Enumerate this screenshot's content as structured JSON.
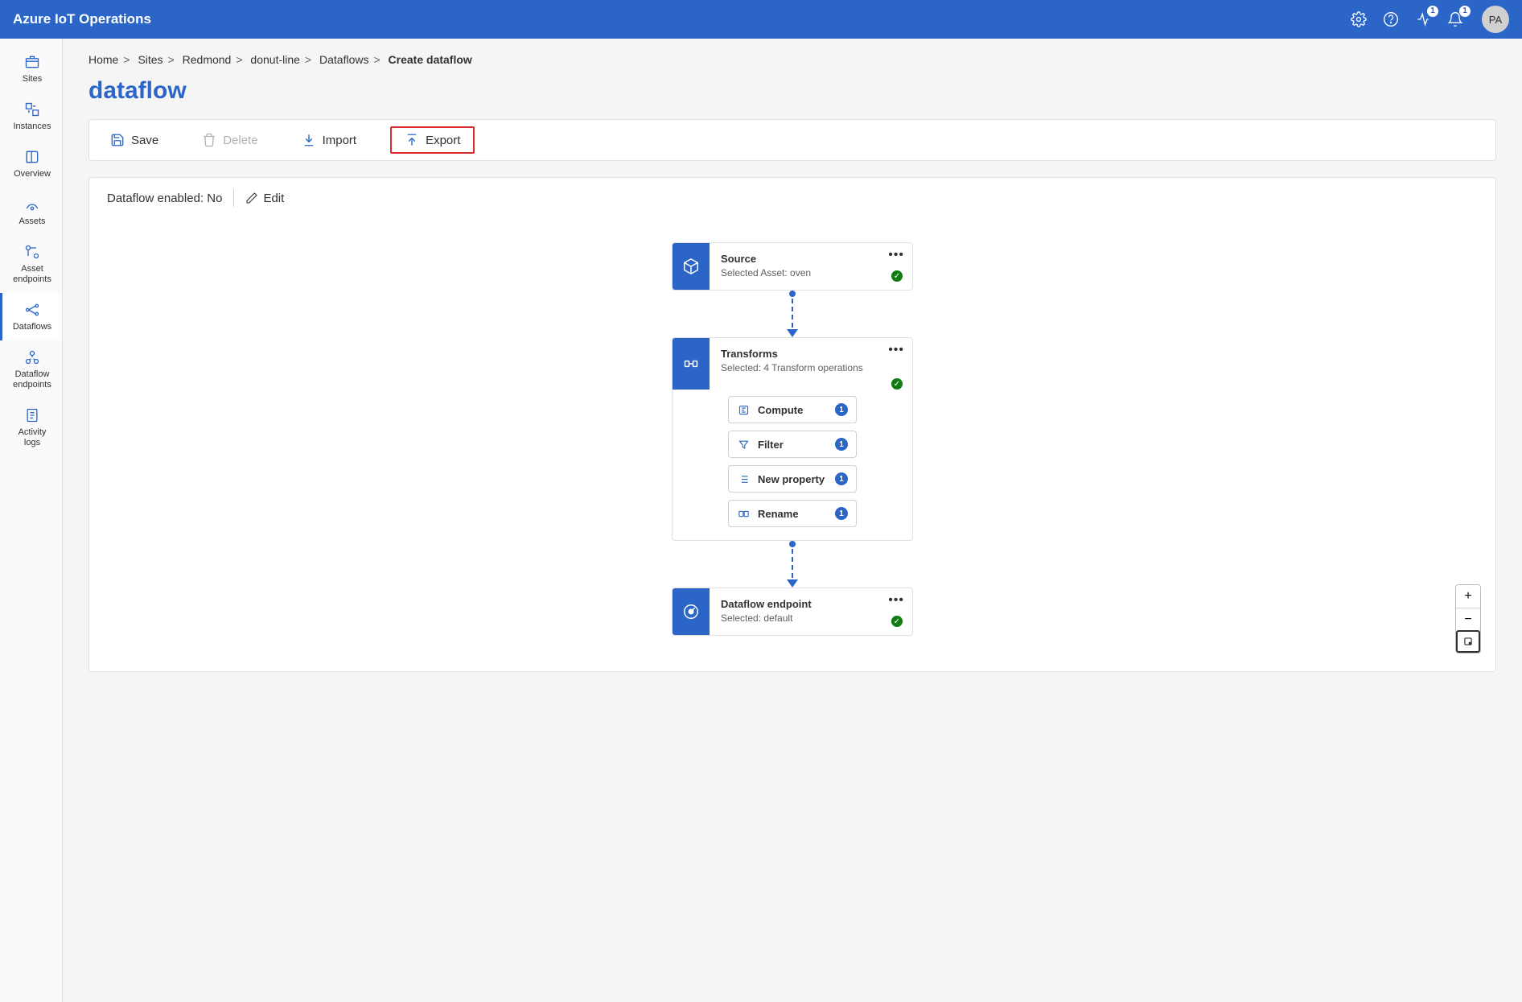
{
  "header": {
    "brand": "Azure IoT Operations",
    "avatar": "PA",
    "diag_badge": "1",
    "bell_badge": "1"
  },
  "nav": {
    "items": [
      {
        "label": "Sites"
      },
      {
        "label": "Instances"
      },
      {
        "label": "Overview"
      },
      {
        "label": "Assets"
      },
      {
        "label": "Asset\nendpoints"
      },
      {
        "label": "Dataflows"
      },
      {
        "label": "Dataflow\nendpoints"
      },
      {
        "label": "Activity\nlogs"
      }
    ]
  },
  "breadcrumb": {
    "items": [
      "Home",
      "Sites",
      "Redmond",
      "donut-line",
      "Dataflows"
    ],
    "current": "Create dataflow"
  },
  "page": {
    "title": "dataflow"
  },
  "toolbar": {
    "save": "Save",
    "delete": "Delete",
    "import": "Import",
    "export": "Export"
  },
  "status": {
    "label": "Dataflow enabled:",
    "value": "No",
    "edit": "Edit"
  },
  "flow": {
    "source": {
      "title": "Source",
      "subtitle": "Selected Asset: oven"
    },
    "transforms": {
      "title": "Transforms",
      "subtitle": "Selected: 4 Transform operations",
      "ops": [
        {
          "label": "Compute",
          "count": "1"
        },
        {
          "label": "Filter",
          "count": "1"
        },
        {
          "label": "New property",
          "count": "1"
        },
        {
          "label": "Rename",
          "count": "1"
        }
      ]
    },
    "endpoint": {
      "title": "Dataflow endpoint",
      "subtitle": "Selected: default"
    }
  }
}
